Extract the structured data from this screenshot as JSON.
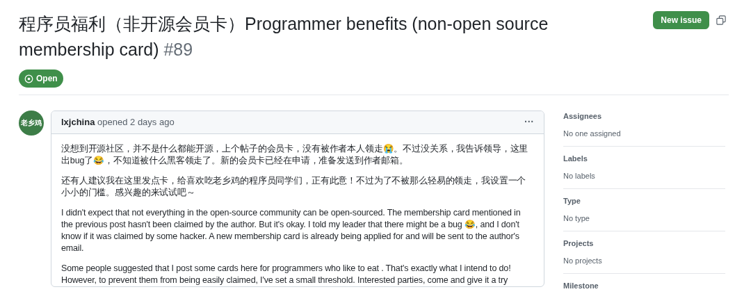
{
  "issue": {
    "title": "程序员福利（非开源会员卡）Programmer benefits (non-open source membership card)",
    "number": "#89",
    "open": true,
    "state_label": "Open"
  },
  "actions": {
    "new_issue": "New issue"
  },
  "comment": {
    "avatar_text": "老乡鸡",
    "author": "lxjchina",
    "meta": "opened 2 days ago",
    "menu": "···",
    "paragraphs": [
      "没想到开源社区，并不是什么都能开源，上个帖子的会员卡，没有被作者本人领走😭。不过没关系，我告诉领导，这里出bug了😂，不知道被什么黑客领走了。新的会员卡已经在申请，准备发送到作者邮箱。",
      "还有人建议我在这里发点卡，给喜欢吃老乡鸡的程序员同学们，正有此意！不过为了不被那么轻易的领走，我设置一个小小的门槛。感兴趣的来试试吧～",
      "I didn't expect that not everything in the open-source community can be open-sourced. The membership card mentioned in the previous post hasn't been claimed by the author. But it's okay. I told my leader that there might be a bug 😂, and I don't know if it was claimed by some hacker. A new membership card is already being applied for and will be sent to the author's email.",
      "Some people suggested that I post some cards here for programmers who like to eat . That's exactly what I intend to do! However, to prevent them from being easily claimed, I've set a small threshold. Interested parties, come and give it a try"
    ]
  },
  "sidebar": [
    {
      "heading": "Assignees",
      "value": "No one assigned"
    },
    {
      "heading": "Labels",
      "value": "No labels"
    },
    {
      "heading": "Type",
      "value": "No type"
    },
    {
      "heading": "Projects",
      "value": "No projects"
    },
    {
      "heading": "Milestone"
    }
  ]
}
